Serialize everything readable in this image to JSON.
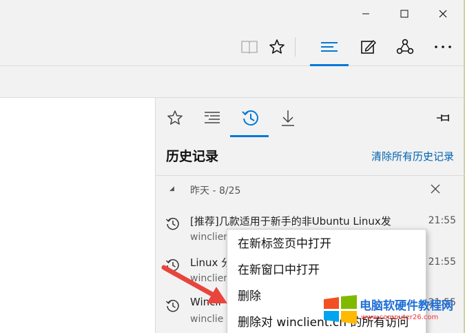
{
  "window_controls": {
    "minimize": "minimize-icon",
    "maximize": "maximize-icon",
    "close": "close-icon"
  },
  "toolbar": {
    "buttons": [
      "reading-view-icon",
      "favorite-star-icon",
      "hub-icon",
      "web-note-icon",
      "share-icon",
      "more-icon"
    ],
    "active": "hub-icon",
    "accent": "#0078d7"
  },
  "hub": {
    "tabs": [
      "favorites-icon",
      "reading-list-icon",
      "history-icon",
      "downloads-icon"
    ],
    "active_tab": "history-icon",
    "title": "历史记录",
    "clear_all": "清除所有历史记录",
    "group": {
      "label": "昨天 - 8/25"
    },
    "items": [
      {
        "title": "[推荐]几款适用于新手的非Ubuntu Linux发",
        "url": "winclient",
        "time": "21:55"
      },
      {
        "title": "Linux 分",
        "url": "winclien",
        "time": "21:55"
      },
      {
        "title": "Wincli",
        "url": "winclie",
        "time": "21:55"
      }
    ]
  },
  "context_menu": {
    "items": [
      "在新标签页中打开",
      "在新窗口中打开",
      "删除",
      "删除对 winclient.cn 的所有访问"
    ]
  },
  "watermark": {
    "title": "电脑软硬件教程网",
    "url": "www.computer26.com"
  }
}
